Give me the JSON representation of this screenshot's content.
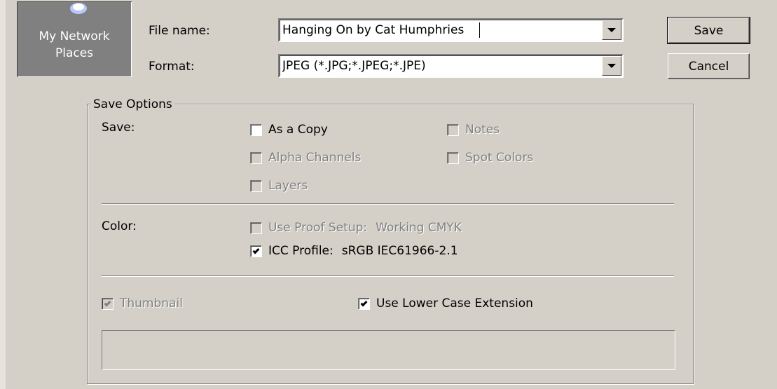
{
  "places": {
    "label_line1": "My Network",
    "label_line2": "Places",
    "icon": "network-places-icon"
  },
  "file_name": {
    "label": "File name:",
    "value": "Hanging On by Cat Humphries"
  },
  "format": {
    "label": "Format:",
    "value": "JPEG (*.JPG;*.JPEG;*.JPE)"
  },
  "buttons": {
    "save": "Save",
    "cancel": "Cancel"
  },
  "save_options": {
    "title": "Save Options",
    "save_label": "Save:",
    "as_a_copy": {
      "label": "As a Copy",
      "checked": false,
      "enabled": true
    },
    "notes": {
      "label": "Notes",
      "checked": false,
      "enabled": false
    },
    "alpha_channels": {
      "label": "Alpha Channels",
      "checked": false,
      "enabled": false
    },
    "spot_colors": {
      "label": "Spot Colors",
      "checked": false,
      "enabled": false
    },
    "layers": {
      "label": "Layers",
      "checked": false,
      "enabled": false
    },
    "color_label": "Color:",
    "use_proof_setup": {
      "label": "Use Proof Setup:",
      "value": "Working CMYK",
      "checked": false,
      "enabled": false
    },
    "icc_profile": {
      "label": "ICC Profile:",
      "value": "sRGB IEC61966-2.1",
      "checked": true,
      "enabled": true
    },
    "thumbnail": {
      "label": "Thumbnail",
      "checked": true,
      "enabled": false
    },
    "lower_case_extension": {
      "label": "Use Lower Case Extension",
      "checked": true,
      "enabled": true
    }
  },
  "colors": {
    "dialog_bg": "#d4d0c8",
    "places_bg": "#808080",
    "disabled_text": "#808080"
  }
}
